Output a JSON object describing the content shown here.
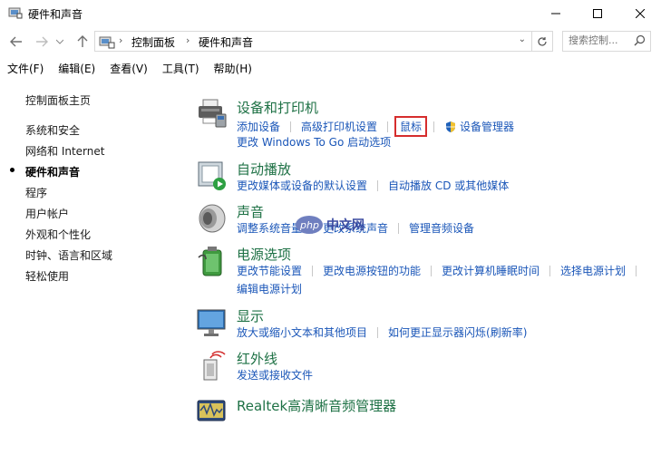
{
  "window": {
    "title": "硬件和声音"
  },
  "address": {
    "crumbs": [
      "控制面板",
      "硬件和声音"
    ],
    "search_placeholder": "搜索控制..."
  },
  "menu": [
    "文件(F)",
    "编辑(E)",
    "查看(V)",
    "工具(T)",
    "帮助(H)"
  ],
  "sidebar": {
    "home": "控制面板主页",
    "items": [
      "系统和安全",
      "网络和 Internet",
      "硬件和声音",
      "程序",
      "用户帐户",
      "外观和个性化",
      "时钟、语言和区域",
      "轻松使用"
    ],
    "active_index": 2
  },
  "categories": [
    {
      "title": "设备和打印机",
      "icon": "printer-icon",
      "rows": [
        [
          "添加设备",
          "高级打印机设置",
          "鼠标",
          "设备管理器"
        ],
        [
          "更改 Windows To Go 启动选项"
        ]
      ]
    },
    {
      "title": "自动播放",
      "icon": "autoplay-icon",
      "rows": [
        [
          "更改媒体或设备的默认设置",
          "自动播放 CD 或其他媒体"
        ]
      ]
    },
    {
      "title": "声音",
      "icon": "speaker-icon",
      "rows": [
        [
          "调整系统音量",
          "更改系统声音",
          "管理音频设备"
        ]
      ]
    },
    {
      "title": "电源选项",
      "icon": "battery-icon",
      "rows": [
        [
          "更改节能设置",
          "更改电源按钮的功能",
          "更改计算机睡眠时间",
          "选择电源计划"
        ],
        [
          "编辑电源计划"
        ]
      ]
    },
    {
      "title": "显示",
      "icon": "monitor-icon",
      "rows": [
        [
          "放大或缩小文本和其他项目",
          "如何更正显示器闪烁(刷新率)"
        ]
      ]
    },
    {
      "title": "红外线",
      "icon": "infrared-icon",
      "rows": [
        [
          "发送或接收文件"
        ]
      ]
    },
    {
      "title": "Realtek高清晰音频管理器",
      "icon": "realtek-icon",
      "rows": []
    }
  ],
  "watermark": "中文网",
  "colors": {
    "link": "#1a56b8",
    "category_title": "#1e7145",
    "highlight": "#d62d2d"
  }
}
